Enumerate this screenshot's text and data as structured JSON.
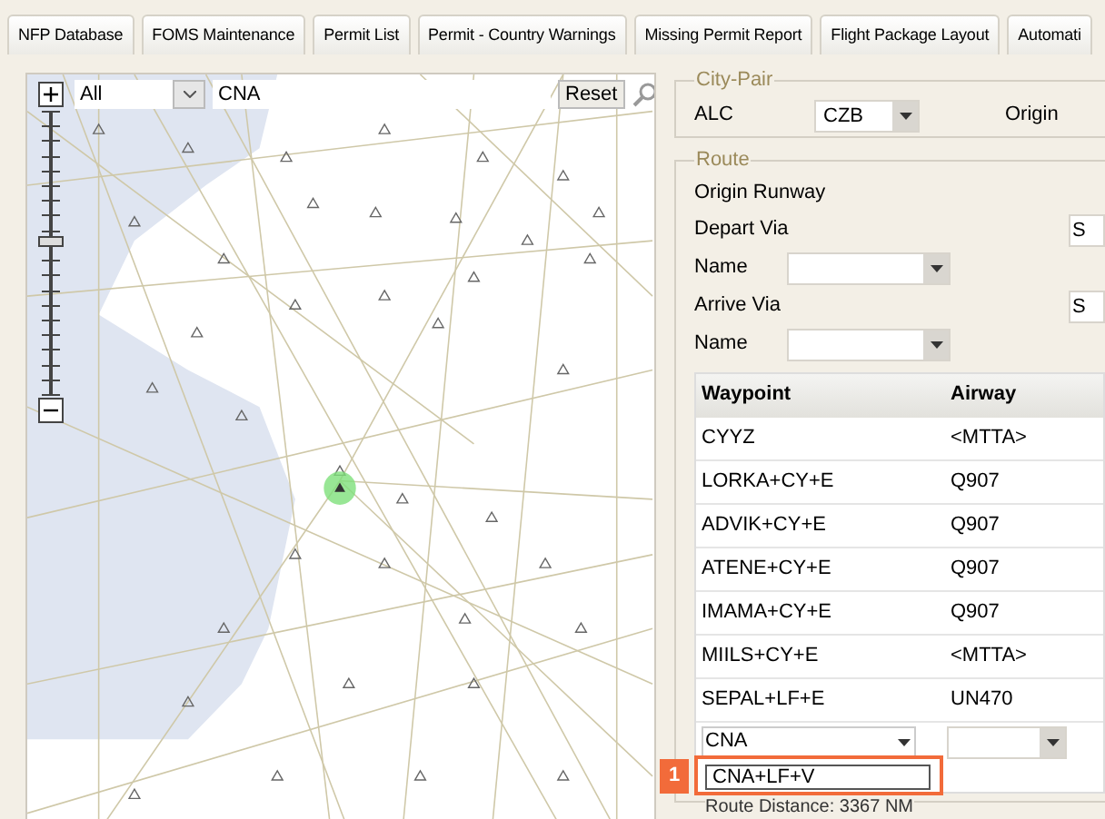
{
  "tabs": [
    {
      "label": "NFP Database",
      "selected": false
    },
    {
      "label": "FOMS Maintenance",
      "selected": false
    },
    {
      "label": "Permit List",
      "selected": false
    },
    {
      "label": "Permit - Country Warnings",
      "selected": false
    },
    {
      "label": "Missing Permit Report",
      "selected": false
    },
    {
      "label": "Flight Package Layout",
      "selected": false
    },
    {
      "label": "Automati",
      "selected": false
    }
  ],
  "map": {
    "filter": {
      "value": "All"
    },
    "search": {
      "value": "CNA"
    },
    "reset_button": "Reset",
    "zoom": {
      "level": 0.54
    }
  },
  "city_pair": {
    "legend": "City-Pair",
    "alc_label": "ALC",
    "alc_value": "CZB",
    "origin_label": "Origin"
  },
  "route": {
    "legend": "Route",
    "origin_runway_label": "Origin Runway",
    "depart_via_label": "Depart Via",
    "depart_via_value": "S",
    "depart_name_label": "Name",
    "arrive_via_label": "Arrive Via",
    "arrive_via_value": "S",
    "arrive_name_label": "Name",
    "table": {
      "columns": [
        "Waypoint",
        "Airway"
      ],
      "rows": [
        {
          "waypoint": "CYYZ",
          "airway": "<MTTA>"
        },
        {
          "waypoint": "LORKA+CY+E",
          "airway": "Q907"
        },
        {
          "waypoint": "ADVIK+CY+E",
          "airway": "Q907"
        },
        {
          "waypoint": "ATENE+CY+E",
          "airway": "Q907"
        },
        {
          "waypoint": "IMAMA+CY+E",
          "airway": "Q907"
        },
        {
          "waypoint": "MIILS+CY+E",
          "airway": "<MTTA>"
        },
        {
          "waypoint": "SEPAL+LF+E",
          "airway": "UN470"
        }
      ],
      "edit_row": {
        "waypoint_value": "CNA",
        "suggestion": "CNA+LF+V"
      }
    },
    "distance": "Route Distance: 3367 NM"
  },
  "annotation": {
    "label": "1"
  }
}
